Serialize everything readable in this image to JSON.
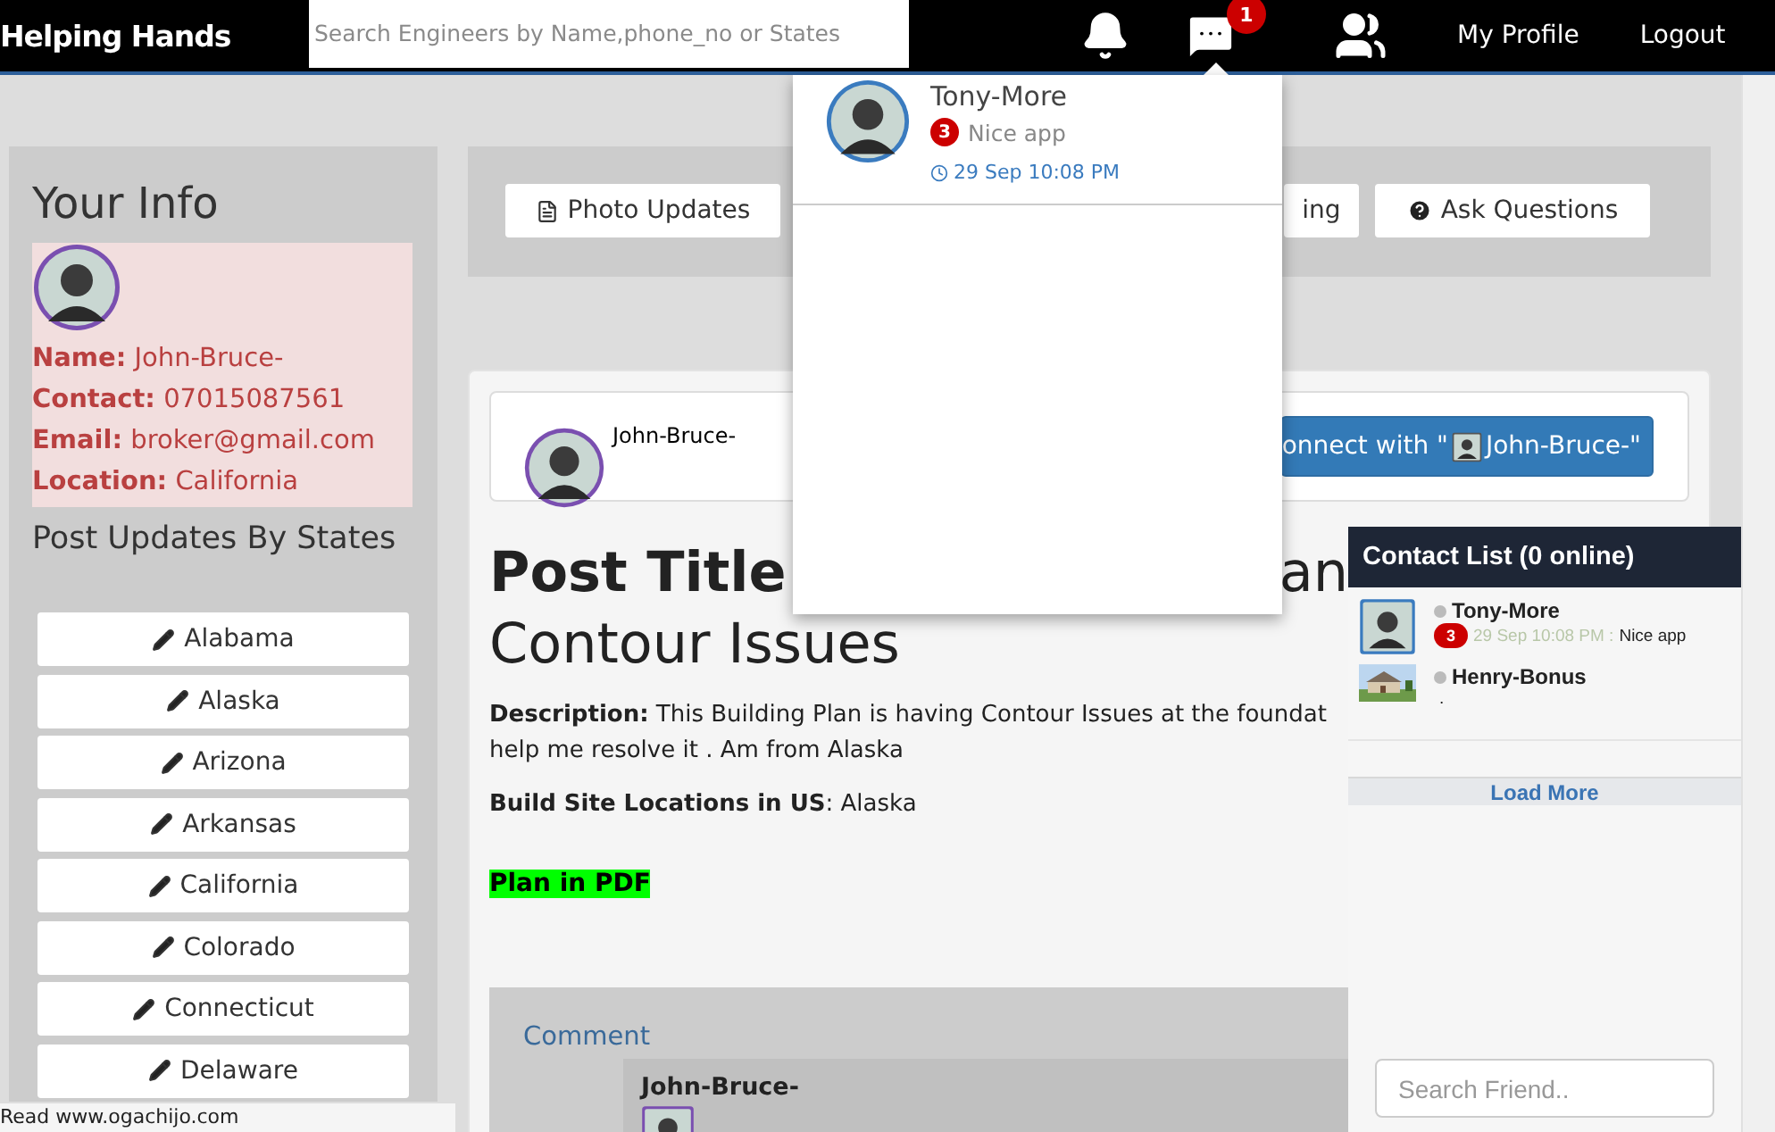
{
  "navbar": {
    "brand": "Helping Hands",
    "search": {
      "placeholder": "Search Engineers by Name,phone_no or States"
    },
    "message_badge": "1",
    "links": [
      "My Profile",
      "Logout"
    ]
  },
  "your_info": {
    "title": "Your Info",
    "fields": [
      {
        "label": "Name:",
        "value": "John-Bruce-"
      },
      {
        "label": "Contact:",
        "value": "07015087561"
      },
      {
        "label": "Email:",
        "value": "broker@gmail.com"
      },
      {
        "label": "Location:",
        "value": "California"
      }
    ]
  },
  "states": {
    "title": "Post Updates By States",
    "items": [
      "Alabama",
      "Alaska",
      "Arizona",
      "Arkansas",
      "California",
      "Colorado",
      "Connecticut",
      "Delaware"
    ]
  },
  "tabs": [
    {
      "label": "Photo Updates"
    },
    {
      "label": "ing",
      "kind": "partial"
    },
    {
      "label": "Ask Questions",
      "kind": "question"
    }
  ],
  "post": {
    "author": "John-Bruce-",
    "connect": {
      "prefix": "onnect with \"",
      "name": "John-Bruce-\""
    },
    "title": {
      "start": "Post Title",
      "end": "an",
      "second_line": "Contour Issues"
    },
    "description_lines": [
      "**Description:** This Building Plan is having Contour Issues at the foundat",
      "help me resolve it . Am from Alaska"
    ],
    "site": "**Build Site Locations in US**: Alaska",
    "pdf_link": "Plan in PDF",
    "comments": {
      "title": "Comment",
      "author": "John-Bruce-"
    }
  },
  "message_dropdown": {
    "items": [
      {
        "name": "Tony-More",
        "count": "3",
        "message": "Nice app",
        "time": "29 Sep 10:08 PM"
      }
    ]
  },
  "contact_list": {
    "title": "Contact List (0 online)",
    "items": [
      {
        "name": "Tony-More",
        "kind": "person",
        "online": false,
        "count": "3",
        "time": "29 Sep 10:08 PM :",
        "message": "Nice app"
      },
      {
        "name": "Henry-Bonus",
        "kind": "house",
        "online": false,
        "message": "."
      }
    ],
    "load_more": "Load More",
    "search": {
      "placeholder": "Search Friend.."
    }
  },
  "status_bar": "Read www.ogachijo.com"
}
